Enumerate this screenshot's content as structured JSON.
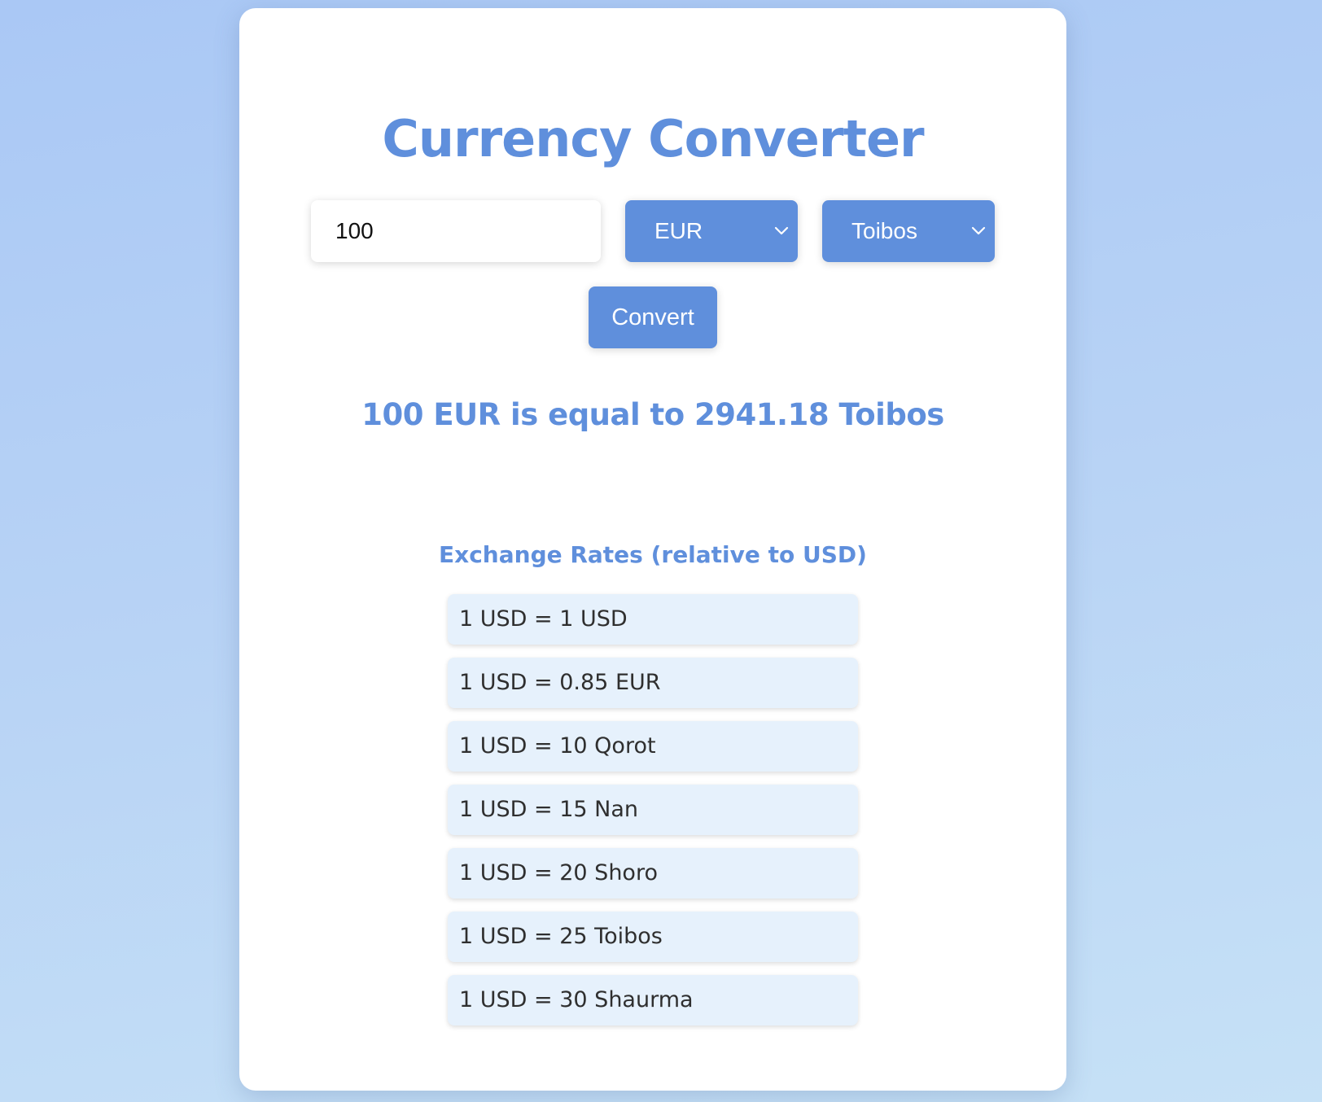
{
  "app": {
    "title": "Currency Converter"
  },
  "converter": {
    "amount": "100",
    "from_currency": "EUR",
    "to_currency": "Toibos",
    "convert_label": "Convert",
    "result_text": "100 EUR is equal to 2941.18 Toibos"
  },
  "rates": {
    "heading": "Exchange Rates (relative to USD)",
    "items": [
      "1 USD = 1 USD",
      "1 USD = 0.85 EUR",
      "1 USD = 10 Qorot",
      "1 USD = 15 Nan",
      "1 USD = 20 Shoro",
      "1 USD = 25 Toibos",
      "1 USD = 30 Shaurma"
    ]
  },
  "colors": {
    "accent": "#5f8fdc",
    "rate_item_bg": "#e6f1fc",
    "card_bg": "#ffffff"
  },
  "icons": {
    "select_arrow": "chevron-down-icon"
  }
}
